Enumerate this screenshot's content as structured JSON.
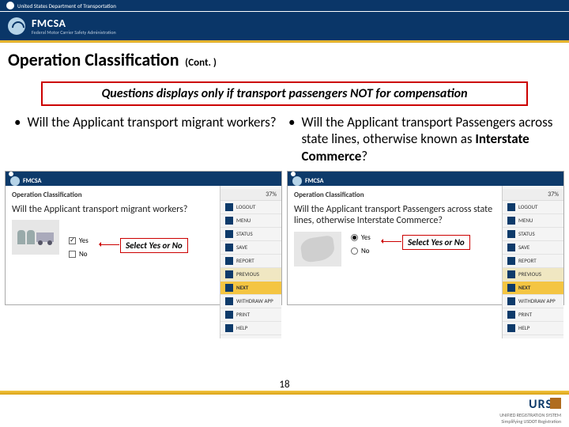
{
  "topbar": {
    "text": "United States Department of Transportation"
  },
  "brand": {
    "name": "FMCSA",
    "sub": "Federal Motor Carrier Safety Administration"
  },
  "heading": {
    "main": "Operation Classification",
    "sub": "(Cont. )"
  },
  "redbox": "Questions displays only if transport passengers NOT for compensation",
  "bullets": {
    "left": "Will the Applicant transport migrant workers?",
    "right_pre": "Will the Applicant transport Passengers across state lines, otherwise known as ",
    "right_bold": "Interstate Commerce",
    "right_post": "?"
  },
  "shots": {
    "left": {
      "brand": "FMCSA",
      "title": "Operation Classification",
      "question": "Will the Applicant transport migrant workers?",
      "opt_yes": "Yes",
      "opt_no": "No",
      "callout": "Select Yes or No",
      "side": {
        "pct": "37%",
        "items": [
          "LOGOUT",
          "MENU",
          "STATUS",
          "SAVE",
          "REPORT",
          "PREVIOUS",
          "NEXT",
          "WITHDRAW APP",
          "PRINT",
          "HELP"
        ]
      }
    },
    "right": {
      "brand": "FMCSA",
      "title": "Operation Classification",
      "question": "Will the Applicant transport Passengers across state lines, otherwise Interstate Commerce?",
      "opt_yes": "Yes",
      "opt_no": "No",
      "callout": "Select Yes or No",
      "side": {
        "pct": "37%",
        "items": [
          "LOGOUT",
          "MENU",
          "STATUS",
          "SAVE",
          "REPORT",
          "PREVIOUS",
          "NEXT",
          "WITHDRAW APP",
          "PRINT",
          "HELP"
        ]
      }
    }
  },
  "footer": {
    "pagenum": "18",
    "urs": "URS",
    "urs_sub": "UNIFIED REGISTRATION SYSTEM",
    "tag": "Simplifying USDOT Registration"
  }
}
